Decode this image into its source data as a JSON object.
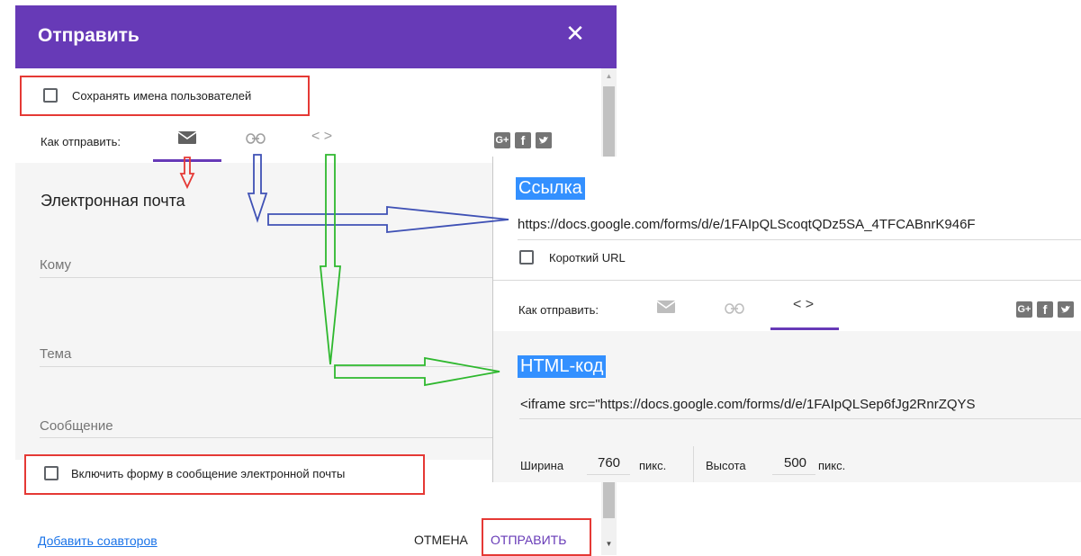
{
  "dialog": {
    "title": "Отправить",
    "close_symbol": "✕",
    "save_names_label": "Сохранять имена пользователей",
    "send_via_label": "Как отправить:",
    "email_heading": "Электронная почта",
    "to_placeholder": "Кому",
    "subject_placeholder": "Тема",
    "message_placeholder": "Сообщение",
    "include_form_label": "Включить форму в сообщение электронной почты",
    "add_collaborators": "Добавить соавторов",
    "cancel": "ОТМЕНА",
    "send": "ОТПРАВИТЬ"
  },
  "social": {
    "gplus": "G+",
    "facebook": "f",
    "twitter": "t"
  },
  "panel": {
    "link_heading": "Ссылка",
    "link_url": "https://docs.google.com/forms/d/e/1FAIpQLScoqtQDz5SA_4TFCABnrK946F",
    "short_url_label": "Короткий URL",
    "send_via_label": "Как отправить:",
    "html_heading": "HTML-код",
    "iframe_code": "<iframe src=\"https://docs.google.com/forms/d/e/1FAIpQLSep6fJg2RnrZQYS",
    "width_label": "Ширина",
    "width_value": "760",
    "width_unit": "пикс.",
    "height_label": "Высота",
    "height_value": "500",
    "height_unit": "пикс."
  },
  "colors": {
    "header": "#673ab7",
    "accent": "#673ab7",
    "annotation_red": "#e53935",
    "annotation_blue": "#3f51b5",
    "annotation_green": "#2eb82e",
    "selection": "#3390ff"
  }
}
